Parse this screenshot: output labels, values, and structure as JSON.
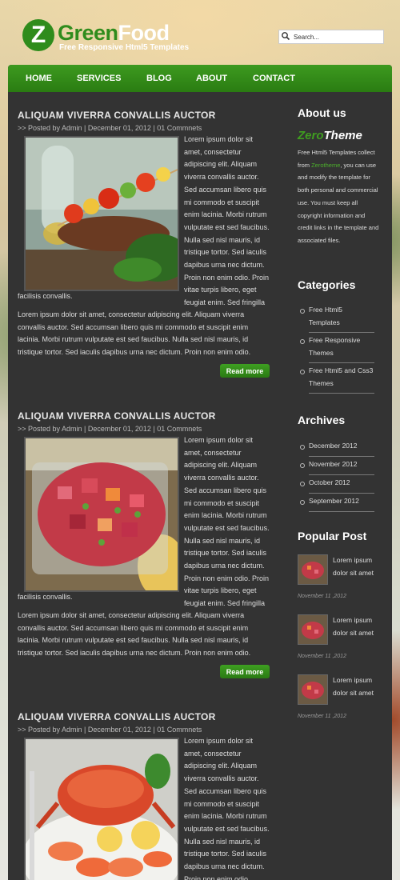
{
  "brand": {
    "logo_letter": "Z",
    "logo_name_green": "Green",
    "logo_name_white": "Food",
    "tagline": "Free Responsive Html5 Templates",
    "color_primary": "#2f8c1c"
  },
  "search": {
    "placeholder": "Search...",
    "icon": "search-icon"
  },
  "nav": {
    "items": [
      "HOME",
      "SERVICES",
      "BLOG",
      "ABOUT",
      "CONTACT"
    ]
  },
  "posts": [
    {
      "title": "ALIQUAM VIVERRA CONVALLIS AUCTOR",
      "meta": ">> Posted by Admin | December 01, 2012 | 01 Commnets",
      "float_text": "Lorem ipsum dolor sit amet, consectetur adipiscing elit. Aliquam viverra convallis auctor. Sed accumsan libero quis mi commodo et suscipit enim lacinia. Morbi rutrum vulputate est sed faucibus. Nulla sed nisl mauris, id tristique tortor. Sed iaculis dapibus urna nec dictum. Proin non enim odio. Proin vitae turpis libero, eget feugiat enim. Sed fringilla",
      "tail": "facilisis convallis.",
      "para2": "Lorem ipsum dolor sit amet, consectetur adipiscing elit. Aliquam viverra convallis auctor. Sed accumsan libero quis mi commodo et suscipit enim lacinia. Morbi rutrum vulputate est sed faucibus. Nulla sed nisl mauris, id tristique tortor. Sed iaculis dapibus urna nec dictum. Proin non enim odio.",
      "more": "Read more",
      "image": "kebab-food-photo"
    },
    {
      "title": "ALIQUAM VIVERRA CONVALLIS AUCTOR",
      "meta": ">> Posted by Admin | December 01, 2012 | 01 Commnets",
      "float_text": "Lorem ipsum dolor sit amet, consectetur adipiscing elit. Aliquam viverra convallis auctor. Sed accumsan libero quis mi commodo et suscipit enim lacinia. Morbi rutrum vulputate est sed faucibus. Nulla sed nisl mauris, id tristique tortor. Sed iaculis dapibus urna nec dictum. Proin non enim odio. Proin vitae turpis libero, eget feugiat enim. Sed fringilla",
      "tail": "facilisis convallis.",
      "para2": "Lorem ipsum dolor sit amet, consectetur adipiscing elit. Aliquam viverra convallis auctor. Sed accumsan libero quis mi commodo et suscipit enim lacinia. Morbi rutrum vulputate est sed faucibus. Nulla sed nisl mauris, id tristique tortor. Sed iaculis dapibus urna nec dictum. Proin non enim odio.",
      "more": "Read more",
      "image": "salad-photo"
    },
    {
      "title": "ALIQUAM VIVERRA CONVALLIS AUCTOR",
      "meta": ">> Posted by Admin | December 01, 2012 | 01 Commnets",
      "float_text": "Lorem ipsum dolor sit amet, consectetur adipiscing elit. Aliquam viverra convallis auctor. Sed accumsan libero quis mi commodo et suscipit enim lacinia. Morbi rutrum vulputate est sed faucibus. Nulla sed nisl mauris, id tristique tortor. Sed iaculis dapibus urna nec dictum. Proin non enim odio.",
      "image": "crab-photo"
    }
  ],
  "sidebar": {
    "about": {
      "heading": "About us",
      "brand_z": "Zero",
      "brand_rest": "Theme",
      "text_before": "Free Html5 Templates collect from",
      "link": "Zerotheme",
      "text_after": ", you can use and modify the template for both personal and commercial use. You must keep all copyright information and credit links in the template and associated files."
    },
    "categories": {
      "heading": "Categories",
      "items": [
        "Free Html5 Templates",
        "Free Responsive Themes",
        "Free Html5 and Css3 Themes"
      ]
    },
    "archives": {
      "heading": "Archives",
      "items": [
        "December 2012",
        "November 2012",
        "October 2012",
        "September 2012"
      ]
    },
    "popular": {
      "heading": "Popular Post",
      "items": [
        {
          "title": "Lorem ipsum dolor sit amet",
          "date": "November 11 ,2012"
        },
        {
          "title": "Lorem ipsum dolor sit amet",
          "date": "November 11 ,2012"
        },
        {
          "title": "Lorem ipsum dolor sit amet",
          "date": "November 11 ,2012"
        }
      ]
    }
  }
}
